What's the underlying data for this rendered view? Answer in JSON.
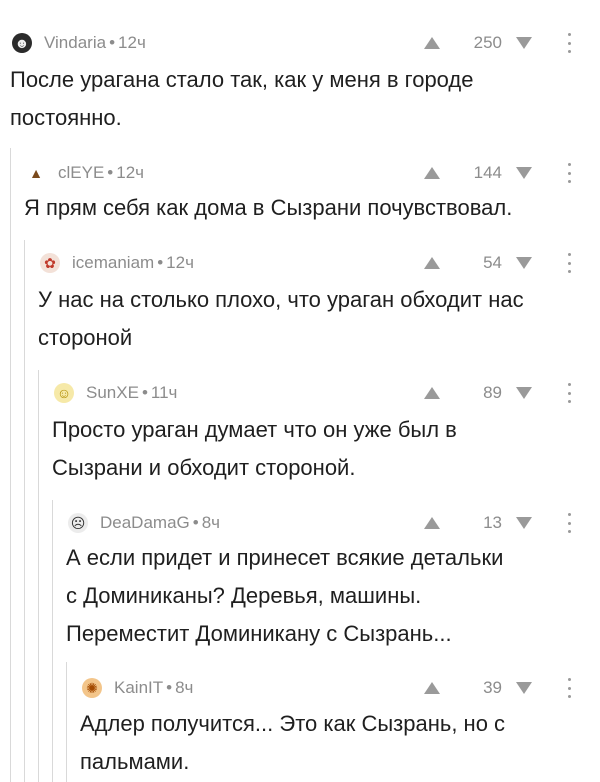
{
  "comments": [
    {
      "author": "Vindaria",
      "time": "12ч",
      "votes": "250",
      "avatar_icon": "dark-portrait-avatar-icon",
      "text_lines": [
        "После урагана стало так, как у меня в городе",
        "постоянно."
      ]
    },
    {
      "author": "clEYE",
      "time": "12ч",
      "votes": "144",
      "avatar_icon": "poop-emoji-avatar-icon",
      "text_lines": [
        "Я прям себя как дома в Сызрани почувствовал."
      ]
    },
    {
      "author": "icemaniam",
      "time": "12ч",
      "votes": "54",
      "avatar_icon": "red-character-avatar-icon",
      "text_lines": [
        "У нас на столько плохо, что ураган обходит нас",
        "стороной"
      ]
    },
    {
      "author": "SunXE",
      "time": "11ч",
      "votes": "89",
      "avatar_icon": "yellow-face-avatar-icon",
      "text_lines": [
        "Просто ураган думает что он уже был в",
        "Сызрани и обходит стороной."
      ]
    },
    {
      "author": "DeaDamaG",
      "time": "8ч",
      "votes": "13",
      "avatar_icon": "sketch-face-avatar-icon",
      "text_lines": [
        "А если придет и принесет всякие детальки",
        "с Доминиканы? Деревья, машины.",
        "Переместит Доминикану с Сызрань..."
      ]
    },
    {
      "author": "KainIT",
      "time": "8ч",
      "votes": "39",
      "avatar_icon": "orange-character-avatar-icon",
      "text_lines": [
        "Адлер получится... Это как Сызрань, но с",
        "пальмами."
      ]
    }
  ],
  "meta_separator": "•"
}
